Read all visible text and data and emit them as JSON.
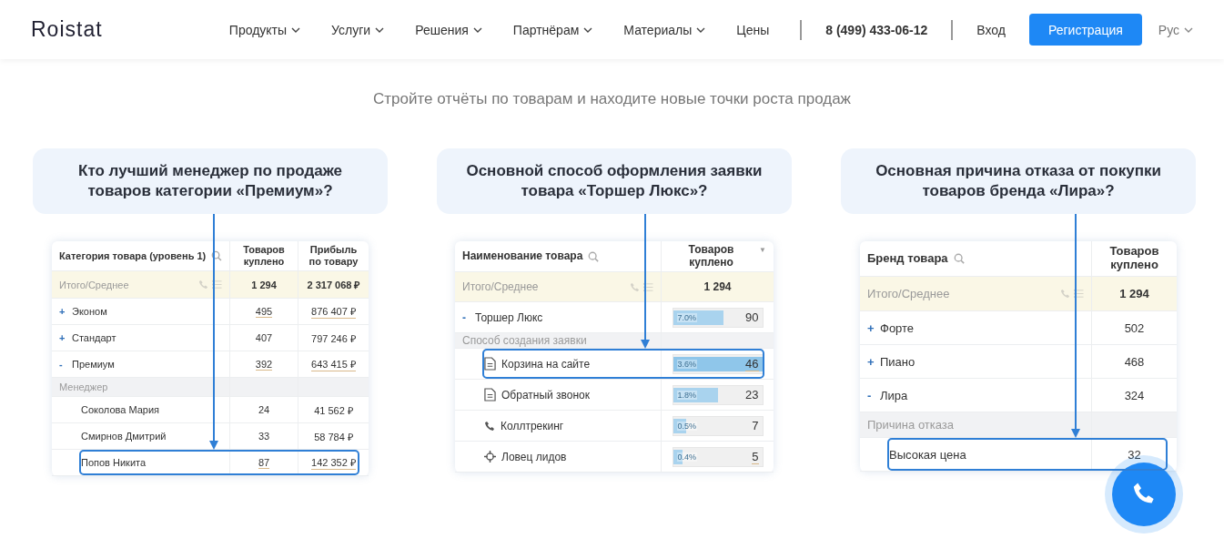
{
  "header": {
    "logo": "Roistat",
    "nav": [
      {
        "label": "Продукты",
        "dropdown": true
      },
      {
        "label": "Услуги",
        "dropdown": true
      },
      {
        "label": "Решения",
        "dropdown": true
      },
      {
        "label": "Партнёрам",
        "dropdown": true
      },
      {
        "label": "Материалы",
        "dropdown": true
      },
      {
        "label": "Цены",
        "dropdown": false
      }
    ],
    "phone": "8 (499) 433-06-12",
    "login": "Вход",
    "register": "Регистрация",
    "language": "Рус"
  },
  "headline": "Стройте отчёты по товарам и находите новые точки роста продаж",
  "cards": [
    {
      "question": "Кто лучший менеджер по продаже товаров категории «Премиум»?",
      "columns": [
        {
          "label": "Категория товара (уровень 1)"
        },
        {
          "label": "Товаров куплено"
        },
        {
          "label": "Прибыль по товару"
        }
      ],
      "rows": [
        {
          "kind": "total",
          "label": "Итого/Среднее",
          "values": [
            {
              "text": "1 294"
            },
            {
              "text": "2 317 068 ₽"
            }
          ]
        },
        {
          "kind": "group",
          "expander": "+",
          "label": "Эконом",
          "values": [
            {
              "text": "495",
              "link": true
            },
            {
              "text": "876 407 ₽",
              "link": true
            }
          ]
        },
        {
          "kind": "group",
          "expander": "+",
          "label": "Стандарт",
          "values": [
            {
              "text": "407"
            },
            {
              "text": "797 246 ₽"
            }
          ]
        },
        {
          "kind": "group",
          "expander": "-",
          "label": "Премиум",
          "values": [
            {
              "text": "392",
              "link": true
            },
            {
              "text": "643 415 ₽",
              "link": true
            }
          ]
        },
        {
          "kind": "section",
          "label": "Менеджер"
        },
        {
          "kind": "child",
          "label": "Соколова Мария",
          "selected": false,
          "values": [
            {
              "text": "24"
            },
            {
              "text": "41 562 ₽"
            }
          ]
        },
        {
          "kind": "child",
          "label": "Смирнов Дмитрий",
          "selected": false,
          "values": [
            {
              "text": "33"
            },
            {
              "text": "58 784 ₽"
            }
          ]
        },
        {
          "kind": "child",
          "label": "Попов Никита",
          "selected": true,
          "values": [
            {
              "text": "87",
              "link": true
            },
            {
              "text": "142 352 ₽",
              "link": true
            }
          ]
        }
      ]
    },
    {
      "question": "Основной способ оформления заявки товара «Торшер Люкс»?",
      "columns": [
        {
          "label": "Наименование товара"
        },
        {
          "label": "Товаров куплено",
          "sort": "▼"
        }
      ],
      "rows": [
        {
          "kind": "total",
          "label": "Итого/Среднее",
          "values": [
            {
              "text": "1 294"
            }
          ]
        },
        {
          "kind": "group",
          "expander": "-",
          "label": "Торшер Люкс",
          "values": [
            {
              "text": "90",
              "bar": "7.0%",
              "level": 0.57
            }
          ]
        },
        {
          "kind": "section",
          "label": "Способ создания заявки"
        },
        {
          "kind": "child",
          "label": "Корзина на сайте",
          "selected": true,
          "values": [
            {
              "text": "46",
              "bar": "3.6%",
              "level": 1,
              "link": true
            }
          ]
        },
        {
          "kind": "child",
          "label": "Обратный звонок",
          "selected": false,
          "values": [
            {
              "text": "23",
              "bar": "1.8%",
              "level": 0.5
            }
          ]
        },
        {
          "kind": "child",
          "label": "Коллтрекинг",
          "selected": false,
          "values": [
            {
              "text": "7",
              "bar": "0.5%",
              "level": 0.15
            }
          ]
        },
        {
          "kind": "child",
          "label": "Ловец лидов",
          "selected": false,
          "values": [
            {
              "text": "5",
              "bar": "0.4%",
              "level": 0.11,
              "link": true
            }
          ]
        }
      ]
    },
    {
      "question": "Основная причина отказа от покупки товаров бренда «Лира»?",
      "columns": [
        {
          "label": "Бренд товара"
        },
        {
          "label": "Товаров куплено"
        }
      ],
      "rows": [
        {
          "kind": "total",
          "label": "Итого/Среднее",
          "values": [
            {
              "text": "1 294"
            }
          ]
        },
        {
          "kind": "group",
          "expander": "+",
          "label": "Форте",
          "values": [
            {
              "text": "502"
            }
          ]
        },
        {
          "kind": "group",
          "expander": "+",
          "label": "Пиано",
          "values": [
            {
              "text": "468"
            }
          ]
        },
        {
          "kind": "group",
          "expander": "-",
          "label": "Лира",
          "values": [
            {
              "text": "324"
            }
          ]
        },
        {
          "kind": "section",
          "label": "Причина отказа"
        },
        {
          "kind": "child",
          "label": "Высокая цена",
          "selected": true,
          "values": [
            {
              "text": "32"
            }
          ]
        }
      ]
    }
  ]
}
